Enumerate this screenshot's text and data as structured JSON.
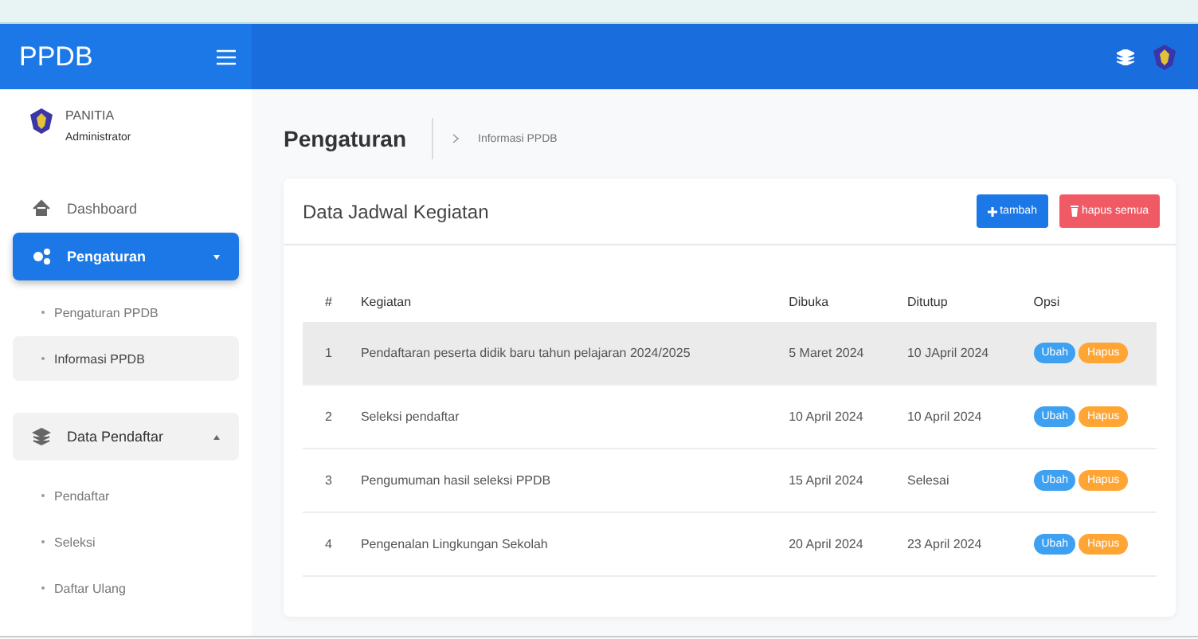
{
  "header": {
    "brand": "PPDB"
  },
  "sidebar": {
    "user": {
      "role": "PANITIA",
      "name": "Administrator"
    },
    "menu": [
      {
        "label": "Dashboard",
        "selected": false,
        "hovered": false
      },
      {
        "label": "Pengaturan",
        "selected": true,
        "hovered": false,
        "children": [
          {
            "label": "Pengaturan PPDB",
            "selected": false
          },
          {
            "label": "Informasi PPDB",
            "selected": true
          }
        ]
      },
      {
        "label": "Data Pendaftar",
        "selected": false,
        "hovered": true,
        "children": [
          {
            "label": "Pendaftar",
            "selected": false
          },
          {
            "label": "Seleksi",
            "selected": false
          },
          {
            "label": "Daftar Ulang",
            "selected": false
          }
        ]
      }
    ]
  },
  "page": {
    "title": "Pengaturan",
    "breadcrumb": "Informasi PPDB"
  },
  "card": {
    "title": "Data Jadwal Kegiatan",
    "buttons": [
      {
        "label": "tambah",
        "kind": "add"
      },
      {
        "label": "hapus semua",
        "kind": "delete"
      }
    ],
    "table": {
      "columns": [
        "#",
        "Kegiatan",
        "Dibuka",
        "Ditutup",
        "Opsi"
      ],
      "rows": [
        {
          "cells": [
            "1",
            "Pendaftaran peserta didik baru tahun pelajaran 2024/2025",
            "5 Maret 2024",
            "10 JApril 2024"
          ],
          "actions": [
            "Ubah",
            "Hapus"
          ],
          "selected": true
        },
        {
          "cells": [
            "2",
            "Seleksi pendaftar",
            "10 April 2024",
            "10 April 2024"
          ],
          "actions": [
            "Ubah",
            "Hapus"
          ],
          "selected": false
        },
        {
          "cells": [
            "3",
            "Pengumuman hasil seleksi PPDB",
            "15 April 2024",
            "Selesai"
          ],
          "actions": [
            "Ubah",
            "Hapus"
          ],
          "selected": false
        },
        {
          "cells": [
            "4",
            "Pengenalan Lingkungan Sekolah",
            "20 April 2024",
            "23 April 2024"
          ],
          "actions": [
            "Ubah",
            "Hapus"
          ],
          "selected": false
        }
      ]
    }
  }
}
